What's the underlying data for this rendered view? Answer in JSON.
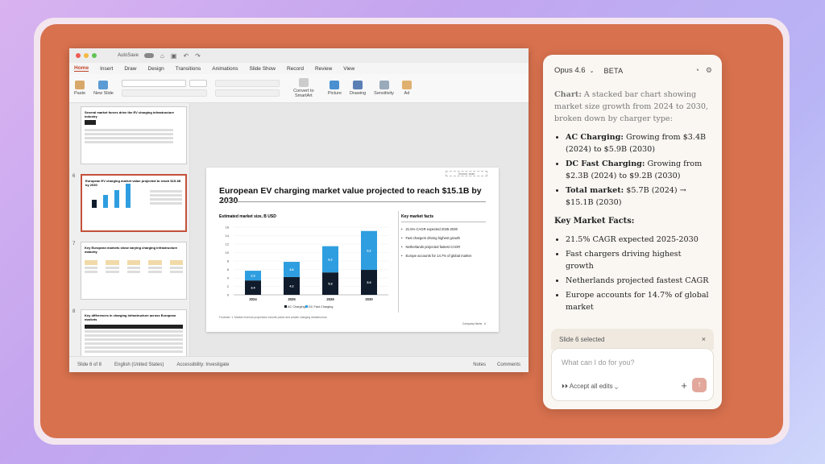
{
  "ppt": {
    "titlebar": {
      "autosave": "AutoSave"
    },
    "tabs": [
      "Home",
      "Insert",
      "Draw",
      "Design",
      "Transitions",
      "Animations",
      "Slide Show",
      "Record",
      "Review",
      "View"
    ],
    "ribbon": {
      "paste": "Paste",
      "new_slide": "New Slide",
      "convert": "Convert to SmartArt",
      "picture": "Picture",
      "drawing": "Drawing",
      "sensitivity": "Sensitivity",
      "add": "Ad"
    },
    "thumbnails": [
      {
        "num": "",
        "title": "Several market forces drive the EV charging infrastructure industry"
      },
      {
        "num": "6",
        "title": "European EV charging market value projected to reach $15.1B by 2030"
      },
      {
        "num": "7",
        "title": "Key European markets show varying charging infrastructure maturity"
      },
      {
        "num": "8",
        "title": "Key differences in charging infrastructure across European markets"
      }
    ],
    "slide": {
      "title": "European EV charging market value projected to reach $15.1B by 2030",
      "source": "Source: chart",
      "chart_title": "Estimated market size, B USD",
      "facts_title": "Key market facts",
      "facts": [
        "21.5% CAGR expected 2025-2030",
        "Fast chargers driving highest growth",
        "Netherlands projected fastest CAGR",
        "Europe accounts for 14.7% of global market"
      ],
      "footnote": "Footnote: 1. Market revenue projections include public and private charging infrastructure",
      "company": "Company Name",
      "page": "6"
    },
    "status": {
      "slide": "Slide 6 of 8",
      "lang": "English (United States)",
      "access": "Accessibility: Investigate",
      "notes": "Notes",
      "comments": "Comments"
    }
  },
  "chart_data": {
    "type": "bar",
    "stacked": true,
    "categories": [
      "2024",
      "2025",
      "2026",
      "2030"
    ],
    "series": [
      {
        "name": "AC Charging",
        "values": [
          3.4,
          4.2,
          5.3,
          5.9
        ],
        "color": "#101c2c"
      },
      {
        "name": "DC Fast Charging",
        "values": [
          2.3,
          3.6,
          6.2,
          9.2
        ],
        "color": "#2e9ee0"
      }
    ],
    "yticks": [
      0,
      2,
      4,
      6,
      8,
      10,
      12,
      14,
      16
    ],
    "ylim": [
      0,
      16
    ],
    "legend": "bottom",
    "title": "Estimated market size, B USD"
  },
  "panel": {
    "model": "Opus 4.6",
    "beta": "BETA",
    "chart_intro_label": "Chart:",
    "chart_intro": "A stacked bar chart showing market size growth from 2024 to 2030, broken down by charger type:",
    "bullets": [
      {
        "label": "AC Charging:",
        "text": "Growing from $3.4B (2024) to $5.9B (2030)"
      },
      {
        "label": "DC Fast Charging:",
        "text": "Growing from $2.3B (2024) to $9.2B (2030)"
      },
      {
        "label": "Total market:",
        "text": "$5.7B (2024) → $15.1B (2030)"
      }
    ],
    "facts_heading": "Key Market Facts:",
    "facts": [
      "21.5% CAGR expected 2025-2030",
      "Fast chargers driving highest growth",
      "Netherlands projected fastest CAGR",
      "Europe accounts for 14.7% of global market"
    ],
    "selected": "Slide 6 selected",
    "placeholder": "What can I do for you?",
    "accept": "Accept all edits",
    "colors": {
      "send": "#e2a89b",
      "bg": "#faf7f3"
    }
  }
}
